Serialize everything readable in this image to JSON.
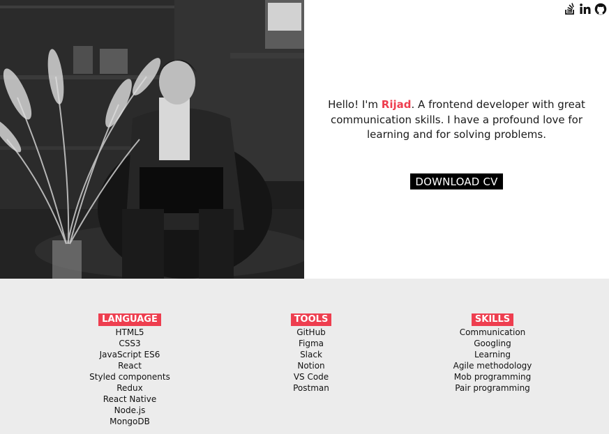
{
  "hero": {
    "photo_alt": "Developer working on a laptop",
    "intro": {
      "greeting": "Hello! I'm ",
      "name": "Rijad",
      "description": ". A frontend developer with great communication skills. I have a profound love for learning and for solving problems."
    },
    "download_button": "DOWNLOAD CV",
    "social": [
      {
        "icon": "stackoverflow-icon"
      },
      {
        "icon": "linkedin-icon"
      },
      {
        "icon": "github-icon"
      }
    ]
  },
  "skills_section": {
    "language": {
      "title": "LANGUAGE",
      "items": [
        "HTML5",
        "CSS3",
        "JavaScript ES6",
        "React",
        "Styled components",
        "Redux",
        "React Native",
        "Node.js",
        "MongoDB"
      ]
    },
    "tools": {
      "title": "TOOLS",
      "items": [
        "GitHub",
        "Figma",
        "Slack",
        "Notion",
        "VS Code",
        "Postman"
      ]
    },
    "skills": {
      "title": "SKILLS",
      "items": [
        "Communication",
        "Googling",
        "Learning",
        "Agile methodology",
        "Mob programming",
        "Pair programming"
      ]
    }
  },
  "colors": {
    "accent": "#ee3e4f",
    "section_bg": "#ececec",
    "button_bg": "#000000"
  }
}
